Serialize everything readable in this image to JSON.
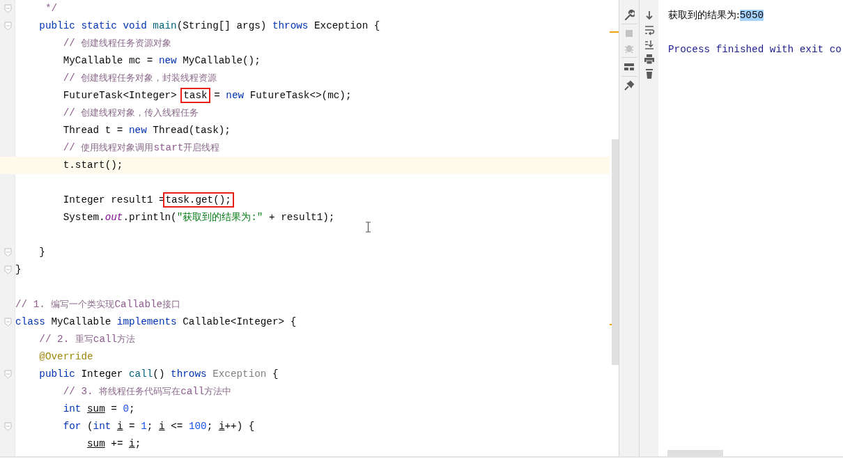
{
  "editor": {
    "lines": [
      {
        "fold": true,
        "current": false,
        "tokens": [
          {
            "kind": "comment",
            "text": "     */"
          }
        ]
      },
      {
        "fold": true,
        "current": false,
        "tokens": [
          {
            "kind": "keyword",
            "text": "    public static void "
          },
          {
            "kind": "method",
            "text": "main"
          },
          {
            "kind": "plain",
            "text": "(String[] args) "
          },
          {
            "kind": "keyword",
            "text": "throws "
          },
          {
            "kind": "plain",
            "text": "Exception {"
          }
        ]
      },
      {
        "fold": false,
        "current": false,
        "tokens": [
          {
            "kind": "comment",
            "text": "        // "
          },
          {
            "kind": "comment-cjk",
            "text": "创建线程任务资源对象"
          }
        ]
      },
      {
        "fold": false,
        "current": false,
        "tokens": [
          {
            "kind": "plain",
            "text": "        MyCallable mc = "
          },
          {
            "kind": "keyword",
            "text": "new "
          },
          {
            "kind": "plain",
            "text": "MyCallable();"
          }
        ]
      },
      {
        "fold": false,
        "current": false,
        "tokens": [
          {
            "kind": "comment",
            "text": "        // "
          },
          {
            "kind": "comment-cjk",
            "text": "创建线程任务对象，封装线程资源"
          }
        ]
      },
      {
        "fold": false,
        "current": false,
        "tokens": [
          {
            "kind": "plain",
            "text": "        FutureTask<Integer> "
          },
          {
            "kind": "boxed",
            "text": "task"
          },
          {
            "kind": "plain",
            "text": " = "
          },
          {
            "kind": "keyword",
            "text": "new "
          },
          {
            "kind": "plain",
            "text": "FutureTask<>(mc);"
          }
        ]
      },
      {
        "fold": false,
        "current": false,
        "tokens": [
          {
            "kind": "comment",
            "text": "        // "
          },
          {
            "kind": "comment-cjk",
            "text": "创建线程对象，传入线程任务"
          }
        ]
      },
      {
        "fold": false,
        "current": false,
        "tokens": [
          {
            "kind": "plain",
            "text": "        Thread t = "
          },
          {
            "kind": "keyword",
            "text": "new "
          },
          {
            "kind": "plain",
            "text": "Thread(task);"
          }
        ]
      },
      {
        "fold": false,
        "current": false,
        "tokens": [
          {
            "kind": "comment",
            "text": "        // "
          },
          {
            "kind": "comment-cjk",
            "text": "使用线程对象调用"
          },
          {
            "kind": "comment",
            "text": "start"
          },
          {
            "kind": "comment-cjk",
            "text": "开启线程"
          }
        ]
      },
      {
        "fold": false,
        "current": true,
        "tokens": [
          {
            "kind": "plain",
            "text": "        t.start();"
          }
        ]
      },
      {
        "fold": false,
        "current": false
      },
      {
        "fold": false,
        "current": false,
        "tokens": [
          {
            "kind": "plain",
            "text": "        Integer result1 ="
          },
          {
            "kind": "boxed",
            "text": "task.get();"
          }
        ]
      },
      {
        "fold": false,
        "current": false,
        "tokens": [
          {
            "kind": "plain",
            "text": "        System."
          },
          {
            "kind": "field",
            "text": "out"
          },
          {
            "kind": "plain",
            "text": ".println("
          },
          {
            "kind": "string",
            "text": "\"获取到的结果为:\""
          },
          {
            "kind": "plain",
            "text": " + result1);"
          }
        ]
      },
      {
        "fold": false,
        "current": false
      },
      {
        "fold": true,
        "current": false,
        "tokens": [
          {
            "kind": "plain",
            "text": "    }"
          }
        ]
      },
      {
        "fold": true,
        "current": false,
        "tokens": [
          {
            "kind": "plain",
            "text": "}"
          }
        ]
      },
      {
        "fold": false,
        "current": false
      },
      {
        "fold": false,
        "current": false,
        "tokens": [
          {
            "kind": "comment",
            "text": "// 1. "
          },
          {
            "kind": "comment-cjk",
            "text": "编写一个类实现"
          },
          {
            "kind": "comment",
            "text": "Callable"
          },
          {
            "kind": "comment-cjk",
            "text": "接口"
          }
        ]
      },
      {
        "fold": true,
        "current": false,
        "tokens": [
          {
            "kind": "keyword",
            "text": "class "
          },
          {
            "kind": "plain",
            "text": "MyCallable "
          },
          {
            "kind": "keyword",
            "text": "implements "
          },
          {
            "kind": "plain",
            "text": "Callable<Integer> {"
          }
        ]
      },
      {
        "fold": false,
        "current": false,
        "tokens": [
          {
            "kind": "comment",
            "text": "    // 2. "
          },
          {
            "kind": "comment-cjk",
            "text": "重写"
          },
          {
            "kind": "comment",
            "text": "call"
          },
          {
            "kind": "comment-cjk",
            "text": "方法"
          }
        ]
      },
      {
        "fold": false,
        "current": false,
        "tokens": [
          {
            "kind": "annotation",
            "text": "    @Override"
          }
        ]
      },
      {
        "fold": true,
        "current": false,
        "tokens": [
          {
            "kind": "keyword",
            "text": "    public "
          },
          {
            "kind": "plain",
            "text": "Integer "
          },
          {
            "kind": "method",
            "text": "call"
          },
          {
            "kind": "plain",
            "text": "() "
          },
          {
            "kind": "keyword",
            "text": "throws "
          },
          {
            "kind": "unused",
            "text": "Exception"
          },
          {
            "kind": "plain",
            "text": " {"
          }
        ]
      },
      {
        "fold": false,
        "current": false,
        "tokens": [
          {
            "kind": "comment",
            "text": "        // 3. "
          },
          {
            "kind": "comment-cjk",
            "text": "将线程任务代码写在"
          },
          {
            "kind": "comment",
            "text": "call"
          },
          {
            "kind": "comment-cjk",
            "text": "方法中"
          }
        ]
      },
      {
        "fold": false,
        "current": false,
        "tokens": [
          {
            "kind": "keyword",
            "text": "        int "
          },
          {
            "kind": "local",
            "text": "sum"
          },
          {
            "kind": "plain",
            "text": " = "
          },
          {
            "kind": "number",
            "text": "0"
          },
          {
            "kind": "plain",
            "text": ";"
          }
        ]
      },
      {
        "fold": true,
        "current": false,
        "tokens": [
          {
            "kind": "keyword",
            "text": "        for "
          },
          {
            "kind": "plain",
            "text": "("
          },
          {
            "kind": "keyword",
            "text": "int "
          },
          {
            "kind": "local",
            "text": "i"
          },
          {
            "kind": "plain",
            "text": " = "
          },
          {
            "kind": "number",
            "text": "1"
          },
          {
            "kind": "plain",
            "text": "; "
          },
          {
            "kind": "local",
            "text": "i"
          },
          {
            "kind": "plain",
            "text": " <= "
          },
          {
            "kind": "number",
            "text": "100"
          },
          {
            "kind": "plain",
            "text": "; "
          },
          {
            "kind": "local",
            "text": "i"
          },
          {
            "kind": "plain",
            "text": "++) {"
          }
        ]
      },
      {
        "fold": false,
        "current": false,
        "tokens": [
          {
            "kind": "local",
            "text": "            sum"
          },
          {
            "kind": "plain",
            "text": " += "
          },
          {
            "kind": "local",
            "text": "i"
          },
          {
            "kind": "plain",
            "text": ";"
          }
        ]
      }
    ]
  },
  "run_toolbar": [
    {
      "kind": "wrench",
      "disabled": false
    },
    {
      "kind": "stop",
      "disabled": true
    },
    {
      "kind": "debug",
      "disabled": true
    },
    {
      "kind": "layout",
      "disabled": false
    },
    {
      "kind": "pin",
      "disabled": false
    }
  ],
  "console_toolbar": [
    {
      "kind": "down",
      "disabled": false
    },
    {
      "kind": "wrap",
      "disabled": false
    },
    {
      "kind": "scroll-end",
      "disabled": false
    },
    {
      "kind": "print",
      "disabled": false
    },
    {
      "kind": "trash",
      "disabled": false
    }
  ],
  "console": {
    "lines": [
      {
        "kind": "output",
        "parts": [
          {
            "text": "获取到的结果为:",
            "selected": false
          },
          {
            "text": "5050",
            "selected": true
          }
        ]
      },
      {
        "kind": "blank"
      },
      {
        "kind": "system",
        "parts": [
          {
            "text": "Process finished with exit co",
            "selected": false
          }
        ]
      }
    ]
  }
}
